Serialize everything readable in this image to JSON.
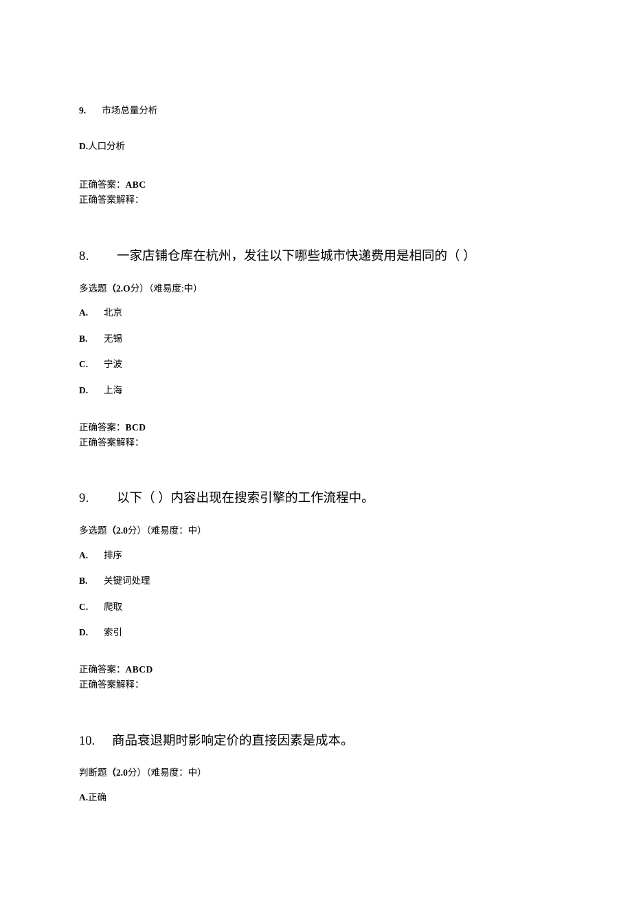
{
  "fragment": {
    "num": "9.",
    "text": "市场总量分析",
    "d_label": "D.",
    "d_text": "人口分析",
    "answer_label": "正确答案：",
    "answer_value": "ABC",
    "explain_label": "正确答案解释："
  },
  "q8": {
    "num": "8.",
    "text": "一家店铺仓库在杭州，发往以下哪些城市快递费用是相同的（            ）",
    "meta_prefix": "多选题",
    "meta_points_l": "（",
    "meta_points_num": "2.O",
    "meta_points_unit": "分）",
    "meta_diff": "（难易度:中）",
    "opts": [
      {
        "letter": "A.",
        "text": "北京"
      },
      {
        "letter": "B.",
        "text": "无锡"
      },
      {
        "letter": "C.",
        "text": "宁波"
      },
      {
        "letter": "D.",
        "text": "上海"
      }
    ],
    "answer_label": "正确答案：",
    "answer_value": "BCD",
    "explain_label": "正确答案解释："
  },
  "q9": {
    "num": "9.",
    "text": "以下（        ）内容出现在搜索引擎的工作流程中。",
    "meta_prefix": "多选题",
    "meta_points_l": "（",
    "meta_points_num": "2.0",
    "meta_points_unit": "分）",
    "meta_diff": "（难易度：中）",
    "opts": [
      {
        "letter": "A.",
        "text": "排序"
      },
      {
        "letter": "B.",
        "text": "关键词处理"
      },
      {
        "letter": "C.",
        "text": "爬取"
      },
      {
        "letter": "D.",
        "text": "索引"
      }
    ],
    "answer_label": "正确答案：",
    "answer_value": "ABCD",
    "explain_label": "正确答案解释："
  },
  "q10": {
    "num": "10.",
    "text": "商品衰退期时影响定价的直接因素是成本。",
    "meta_prefix": "判断题",
    "meta_points_l": "（",
    "meta_points_num": "2.0",
    "meta_points_unit": "分）",
    "meta_diff": "（难易度：中）",
    "a_label": "A.",
    "a_text": "正确"
  }
}
